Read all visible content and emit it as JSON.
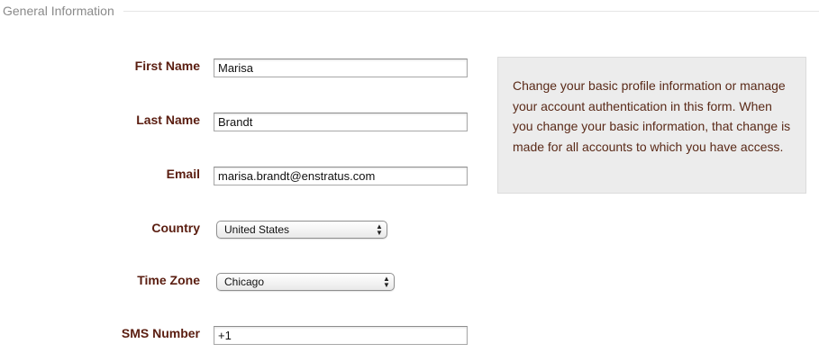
{
  "section": {
    "title": "General Information"
  },
  "form": {
    "first_name": {
      "label": "First Name",
      "value": "Marisa"
    },
    "last_name": {
      "label": "Last Name",
      "value": "Brandt"
    },
    "email": {
      "label": "Email",
      "value": "marisa.brandt@enstratus.com"
    },
    "country": {
      "label": "Country",
      "selected": "United States"
    },
    "time_zone": {
      "label": "Time Zone",
      "selected": "Chicago"
    },
    "sms_number": {
      "label": "SMS Number",
      "value": "+1"
    }
  },
  "help": {
    "text": "Change your basic profile information or manage your account authentication in this form. When you change your basic information, that change is made for all accounts to which you have access."
  },
  "colors": {
    "label": "#5a1d10",
    "help_text": "#5a2a18",
    "help_background": "#ececec"
  }
}
